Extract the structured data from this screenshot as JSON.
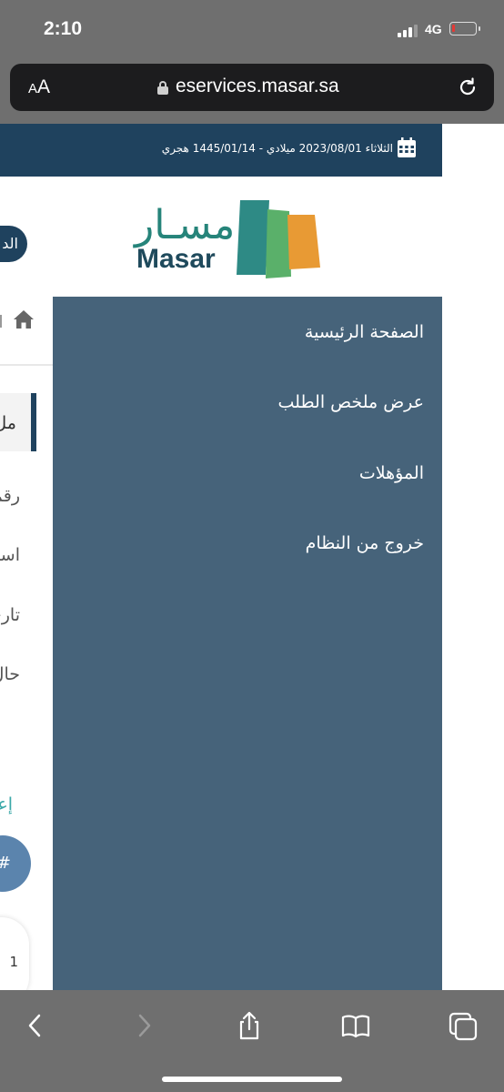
{
  "status_bar": {
    "time": "2:10",
    "network": "4G"
  },
  "address_bar": {
    "text_size_small": "A",
    "text_size_large": "A",
    "url": "eservices.masar.sa"
  },
  "header": {
    "date": "الثلاثاء 2023/08/01 ميلادي - 1445/01/14 هجري"
  },
  "logo": {
    "arabic": "مسـار",
    "english": "Masar",
    "colors": {
      "teal": "#2e8a85",
      "green": "#5ab06a",
      "orange": "#e89a34"
    }
  },
  "background": {
    "login_pill": "الد",
    "card_label": "مل",
    "fields": [
      "رقم",
      "اسم",
      "تاري",
      "حال"
    ],
    "announcements_label": "إعلانا",
    "table_header": "#",
    "table_cell": "1"
  },
  "menu": {
    "items": [
      {
        "label": "الصفحة الرئيسية"
      },
      {
        "label": "عرض ملخص الطلب"
      },
      {
        "label": "المؤهلات"
      },
      {
        "label": "خروج من النظام"
      }
    ]
  },
  "toolbar": {
    "icons": [
      "back-icon",
      "forward-icon",
      "share-icon",
      "bookmarks-icon",
      "tabs-icon"
    ]
  }
}
